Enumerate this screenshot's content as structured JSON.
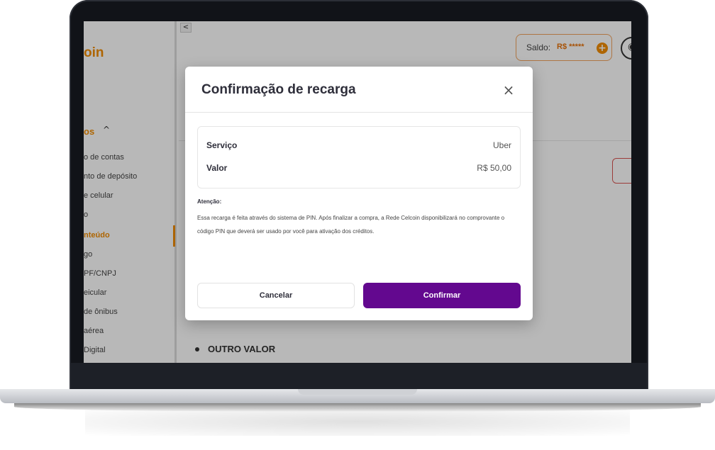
{
  "sidebar": {
    "logo_fragment": "oin",
    "group_title": "os",
    "group_caret": "^",
    "items": [
      {
        "label": "o de contas"
      },
      {
        "label": "nto de depósito"
      },
      {
        "label": "e celular"
      },
      {
        "label": "o"
      },
      {
        "label": "nteúdo",
        "active": true
      },
      {
        "label": "go"
      },
      {
        "label": "PF/CNPJ"
      },
      {
        "label": "eicular"
      },
      {
        "label": "de ônibus"
      },
      {
        "label": "aérea"
      },
      {
        "label": "Digital"
      }
    ]
  },
  "header": {
    "collapse_icon": "chevron-left-icon",
    "collapse_glyph": "<",
    "saldo_label": "Saldo:",
    "saldo_value": "R$ *****",
    "saldo_plus": "+",
    "eye_icon": "eye-icon"
  },
  "main": {
    "outro_label": "OUTRO VALOR"
  },
  "modal": {
    "title": "Confirmação de recarga",
    "close": "×",
    "summary": {
      "service_label": "Serviço",
      "service_value": "Uber",
      "amount_label": "Valor",
      "amount_value": "R$ 50,00"
    },
    "attention_title": "Atenção:",
    "attention_text": "Essa recarga é feita através do sistema de PIN. Após finalizar a compra, a Rede Celcoin disponibilizará no comprovante o código PIN que deverá ser usado por você para ativação dos créditos.",
    "cancel_label": "Cancelar",
    "confirm_label": "Confirmar"
  },
  "colors": {
    "brand_orange": "#f28c00",
    "confirm_purple": "#63088f"
  }
}
